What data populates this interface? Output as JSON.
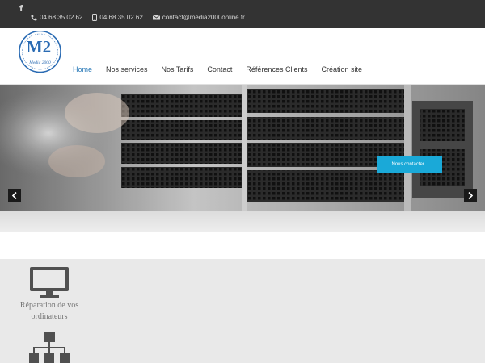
{
  "topbar": {
    "social_icon": "facebook-icon",
    "phone_icon": "phone-icon",
    "phone": "04.68.35.02.62",
    "mobile_icon": "mobile-icon",
    "mobile": "04.68.35.02.62",
    "email_icon": "envelope-icon",
    "email": "contact@media2000online.fr",
    "background": "#333333"
  },
  "logo": {
    "mark": "M2",
    "text": "Media 2000",
    "color": "#2a6bb3"
  },
  "nav": {
    "items": [
      {
        "label": "Home",
        "active": true
      },
      {
        "label": "Nos services",
        "active": false
      },
      {
        "label": "Nos Tarifs",
        "active": false
      },
      {
        "label": "Contact",
        "active": false
      },
      {
        "label": "Références Clients",
        "active": false
      },
      {
        "label": "Création site",
        "active": false
      }
    ],
    "accent": "#2a7ab8"
  },
  "slider": {
    "cta_label": "Nous contacter...",
    "cta_color": "#1aa9d8",
    "prev_icon": "chevron-left-icon",
    "next_icon": "chevron-right-icon"
  },
  "services": [
    {
      "icon": "monitor-icon",
      "title": "Réparation de vos ordinateurs"
    },
    {
      "icon": "network-icon",
      "title": ""
    }
  ]
}
